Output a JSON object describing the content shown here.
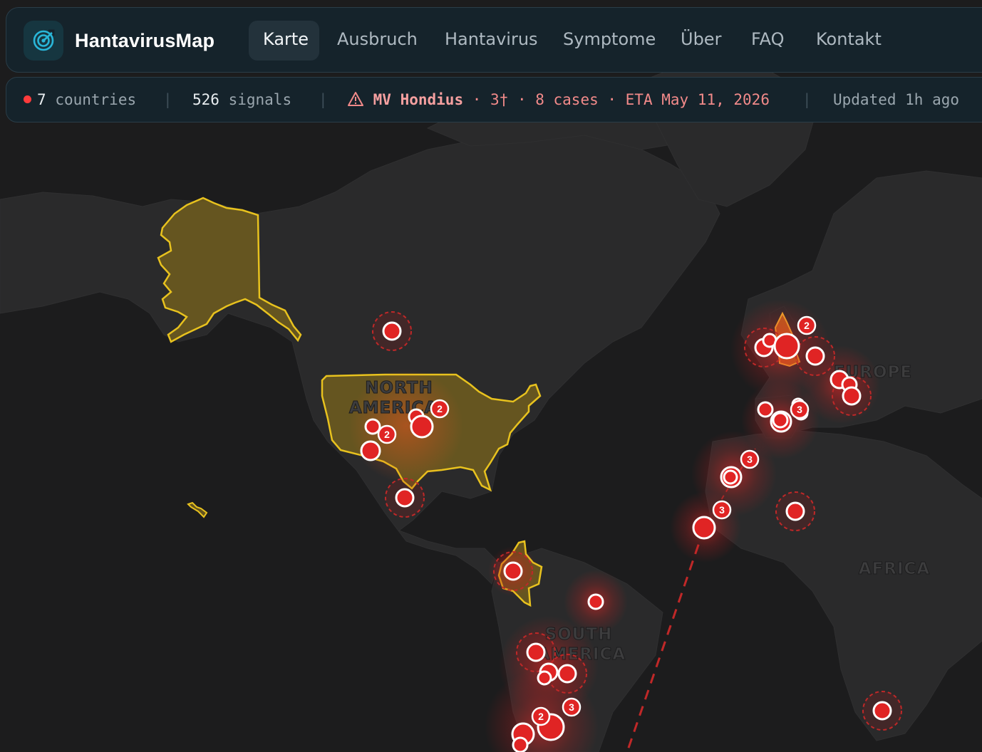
{
  "brand": {
    "name": "HantavirusMap",
    "logo_icon": "radar-icon",
    "accent": "#29b6d8"
  },
  "nav": {
    "items": [
      {
        "label": "Karte",
        "active": true
      },
      {
        "label": "Ausbruch",
        "active": false
      },
      {
        "label": "Hantavirus",
        "active": false
      },
      {
        "label": "Symptome",
        "active": false
      },
      {
        "label": "Über",
        "active": false
      },
      {
        "label": "FAQ",
        "active": false
      },
      {
        "label": "Kontakt",
        "active": false
      }
    ]
  },
  "status": {
    "countries_count": "7",
    "countries_label": "countries",
    "signals_count": "526",
    "signals_label": "signals",
    "alert_icon": "warning-triangle-icon",
    "alert_ship": "MV Hondius",
    "alert_details": " · 3† · 8 cases · ETA May 11, 2026",
    "updated": "Updated 1h ago",
    "separator": "|"
  },
  "map": {
    "labels": {
      "north_america_1": "NORTH",
      "north_america_2": "AMERICA",
      "south_america_1": "SOUTH",
      "south_america_2": "AMERICA",
      "europe": "EUROPE",
      "africa": "AFRICA"
    },
    "colors": {
      "ocean": "#1c1c1d",
      "land": "#2b2b2c",
      "highlight_fill": "#6b5a1f",
      "highlight_stroke": "#e8c21e",
      "marker": "#e02424",
      "route": "#c02828"
    },
    "cluster_counts": [
      "2",
      "2",
      "2",
      "3",
      "3",
      "3",
      "2",
      "3"
    ]
  }
}
